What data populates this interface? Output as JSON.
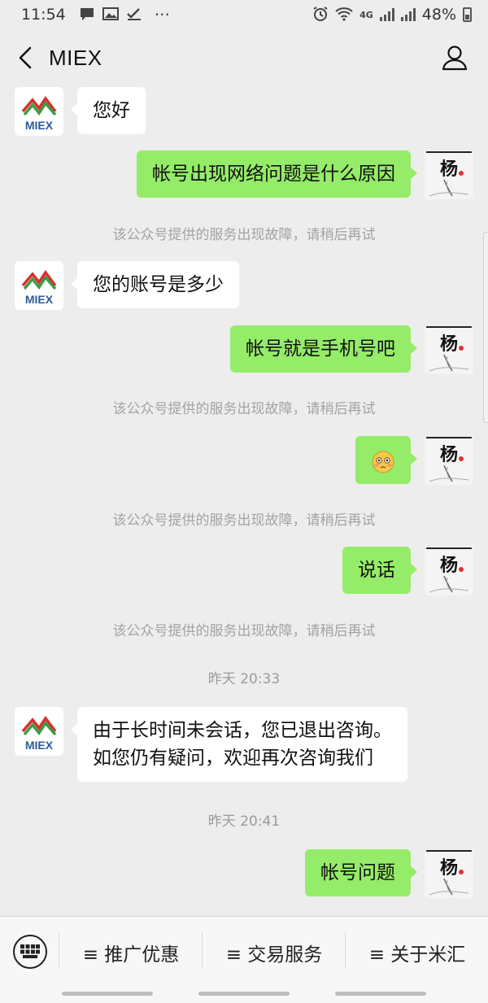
{
  "status_bar": {
    "time": "11:54",
    "dots": "···",
    "network": "4G",
    "battery": "48%",
    "left_icons": [
      "message-icon",
      "image-icon",
      "check-icon"
    ],
    "right_icons": [
      "alarm-icon",
      "wifi-icon",
      "signal-icon",
      "battery-icon"
    ]
  },
  "header": {
    "title": "MIEX",
    "back_icon": "chevron-left-icon",
    "profile_icon": "person-icon"
  },
  "brand": {
    "logo_text": "MIEX",
    "logo_red": "#d9302c",
    "logo_green": "#3f9a46",
    "logo_blue": "#2b5b9a",
    "user_avatar_char": "杨"
  },
  "colors": {
    "outgoing_bubble": "#95ec69",
    "incoming_bubble": "#ffffff",
    "background": "#ededed"
  },
  "messages": [
    {
      "id": "m1",
      "from": "bot",
      "text": "您好"
    },
    {
      "id": "m2",
      "from": "user",
      "text": "帐号出现网络问题是什么原因"
    },
    {
      "id": "s1",
      "type": "system",
      "text": "该公众号提供的服务出现故障，请稍后再试"
    },
    {
      "id": "m3",
      "from": "bot",
      "text": "您的账号是多少"
    },
    {
      "id": "m4",
      "from": "user",
      "text": "帐号就是手机号吧"
    },
    {
      "id": "s2",
      "type": "system",
      "text": "该公众号提供的服务出现故障，请稍后再试"
    },
    {
      "id": "m5",
      "from": "user",
      "emoji": "flushed-face-icon"
    },
    {
      "id": "s3",
      "type": "system",
      "text": "该公众号提供的服务出现故障，请稍后再试"
    },
    {
      "id": "m6",
      "from": "user",
      "text": "说话"
    },
    {
      "id": "s4",
      "type": "system",
      "text": "该公众号提供的服务出现故障，请稍后再试"
    },
    {
      "id": "t1",
      "type": "time",
      "text": "昨天 20:33"
    },
    {
      "id": "m7",
      "from": "bot",
      "lines": [
        "由于长时间未会话，您已退出咨询。",
        "如您仍有疑问，欢迎再次咨询我们"
      ]
    },
    {
      "id": "t2",
      "type": "time",
      "text": "昨天 20:41"
    },
    {
      "id": "m8",
      "from": "user",
      "text": "帐号问题"
    }
  ],
  "bottom_menu": {
    "keyboard_icon": "keyboard-icon",
    "items": [
      {
        "label": "≡ 推广优惠"
      },
      {
        "label": "≡ 交易服务"
      },
      {
        "label": "≡ 关于米汇"
      }
    ]
  }
}
